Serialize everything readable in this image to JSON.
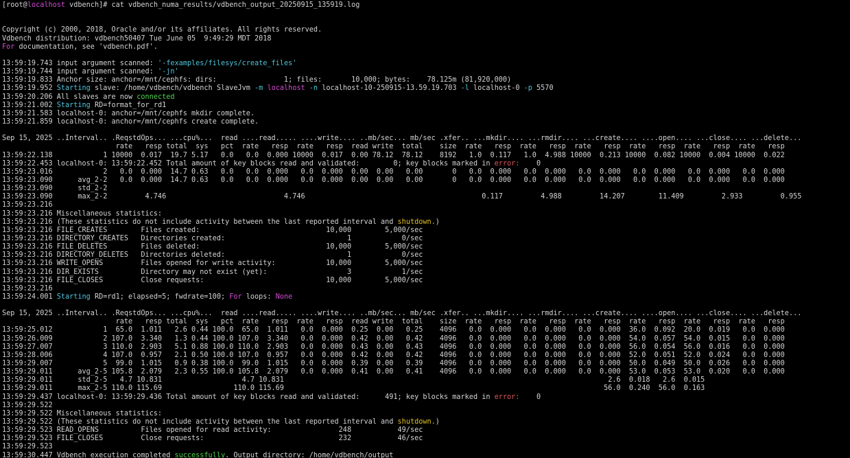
{
  "colors": {
    "background": "#000000",
    "default": "#d3d3d3",
    "host": "#d24ad2",
    "cyan": "#4fc3d9",
    "magenta": "#d24ad2",
    "red": "#e05555",
    "yellow": "#e0c020",
    "green": "#4ed04e"
  },
  "lines": [
    [
      {
        "t": "[root@"
      },
      {
        "t": "localhost",
        "c": "host"
      },
      {
        "t": " vdbench]# cat vdbench_numa_results/vdbench_output_20250915_135919.log"
      }
    ],
    [],
    [],
    [
      {
        "t": "Copyright (c) 2000, 2018, Oracle and/or its affiliates. All rights reserved."
      }
    ],
    [
      {
        "t": "Vdbench distribution: vdbench50407 Tue June 05  9:49:29 MDT 2018"
      }
    ],
    [
      {
        "t": "For",
        "c": "magenta"
      },
      {
        "t": " documentation, see 'vdbench.pdf'."
      }
    ],
    [],
    [
      {
        "t": "13:59:19.743 input argument scanned: "
      },
      {
        "t": "'-fexamples/filesys/create_files'",
        "c": "cyan"
      }
    ],
    [
      {
        "t": "13:59:19.744 input argument scanned: "
      },
      {
        "t": "'-jn'",
        "c": "cyan"
      }
    ],
    [
      {
        "t": "13:59:19.833 Anchor size: anchor=/mnt/cephfs: dirs:                1; files:       10,000; bytes:    78.125m (81,920,000)"
      }
    ],
    [
      {
        "t": "13:59:19.952 "
      },
      {
        "t": "Starting",
        "c": "cyan"
      },
      {
        "t": " slave: /home/vdbench/vdbench SlaveJvm "
      },
      {
        "t": "-m",
        "c": "cyan"
      },
      {
        "t": " "
      },
      {
        "t": "localhost",
        "c": "magenta"
      },
      {
        "t": " "
      },
      {
        "t": "-n",
        "c": "cyan"
      },
      {
        "t": " localhost-10-250915-13.59.19.703 "
      },
      {
        "t": "-l",
        "c": "cyan"
      },
      {
        "t": " localhost-0 "
      },
      {
        "t": "-p",
        "c": "cyan"
      },
      {
        "t": " 5570"
      }
    ],
    [
      {
        "t": "13:59:20.206 All slaves are now "
      },
      {
        "t": "connected",
        "c": "green"
      }
    ],
    [
      {
        "t": "13:59:21.002 "
      },
      {
        "t": "Starting",
        "c": "cyan"
      },
      {
        "t": " RD=format_for_rd1"
      }
    ],
    [
      {
        "t": "13:59:21.583 localhost-0: anchor=/mnt/cephfs mkdir complete."
      }
    ],
    [
      {
        "t": "13:59:21.859 localhost-0: anchor=/mnt/cephfs create complete."
      }
    ],
    [],
    [
      {
        "t": "Sep 15, 2025 ..Interval.. .ReqstdOps... ...cpu%...  read ....read..... ....write.... ..mb/sec... mb/sec .xfer.. ...mkdir.... ...rmdir.... ...create.... ....open.... ...close.... ...delete..."
      }
    ],
    [
      {
        "t": "                           rate   resp total  sys   pct  rate   resp  rate   resp  read write  total    size  rate   resp  rate   resp  rate   resp  rate   resp  rate   resp  rate   resp"
      }
    ],
    [
      {
        "t": "13:59:22.138            1 10000  0.017  19.7 5.17   0.0   0.0  0.000 10000  0.017  0.00 78.12  78.12    8192   1.0  0.117   1.0  4.988 10000  0.213 10000  0.082 10000  0.004 10000  0.022"
      }
    ],
    [
      {
        "t": "13:59:22.453 localhost-0: 13:59:22.452 Total amount of key blocks read and validated:        0; key blocks marked in "
      },
      {
        "t": "error:",
        "c": "red"
      },
      {
        "t": "    0"
      }
    ],
    [
      {
        "t": "13:59:23.016            2   0.0  0.000  14.7 0.63   0.0   0.0  0.000   0.0  0.000  0.00  0.00   0.00       0   0.0  0.000   0.0  0.000   0.0  0.000   0.0  0.000   0.0  0.000   0.0  0.000"
      }
    ],
    [
      {
        "t": "13:59:23.090      avg_2-2   0.0  0.000  14.7 0.63   0.0   0.0  0.000   0.0  0.000  0.00  0.00   0.00       0   0.0  0.000   0.0  0.000   0.0  0.000   0.0  0.000   0.0  0.000   0.0  0.000"
      }
    ],
    [
      {
        "t": "13:59:23.090      std_2-2"
      }
    ],
    [
      {
        "t": "13:59:23.090      max_2-2         4.746                            4.746                                          0.117         4.988         14.207        11.409         2.933         0.955"
      }
    ],
    [
      {
        "t": "13:59:23.216"
      }
    ],
    [
      {
        "t": "13:59:23.216 Miscellaneous statistics:"
      }
    ],
    [
      {
        "t": "13:59:23.216 (These statistics do not include activity between the last reported interval and "
      },
      {
        "t": "shutdown.",
        "c": "yellow"
      },
      {
        "t": ")"
      }
    ],
    [
      {
        "t": "13:59:23.216 FILE_CREATES        Files created:                              10,000        5,000/sec"
      }
    ],
    [
      {
        "t": "13:59:23.216 DIRECTORY_CREATES   Directories created:                             1            0/sec"
      }
    ],
    [
      {
        "t": "13:59:23.216 FILE_DELETES        Files deleted:                              10,000        5,000/sec"
      }
    ],
    [
      {
        "t": "13:59:23.216 DIRECTORY_DELETES   Directories deleted:                             1            0/sec"
      }
    ],
    [
      {
        "t": "13:59:23.216 WRITE_OPENS         Files opened for write activity:            10,000        5,000/sec"
      }
    ],
    [
      {
        "t": "13:59:23.216 DIR_EXISTS          Directory may not exist (yet):                   3            1/sec"
      }
    ],
    [
      {
        "t": "13:59:23.216 FILE_CLOSES         Close requests:                             10,000        5,000/sec"
      }
    ],
    [
      {
        "t": "13:59:23.216"
      }
    ],
    [
      {
        "t": "13:59:24.001 "
      },
      {
        "t": "Starting",
        "c": "cyan"
      },
      {
        "t": " RD=rd1; elapsed=5; fwdrate=100; "
      },
      {
        "t": "For",
        "c": "magenta"
      },
      {
        "t": " loops: "
      },
      {
        "t": "None",
        "c": "magenta"
      }
    ],
    [],
    [
      {
        "t": "Sep 15, 2025 ..Interval.. .ReqstdOps... ...cpu%...  read ....read..... ....write.... ..mb/sec... mb/sec .xfer.. ...mkdir.... ...rmdir.... ...create.... ....open.... ...close.... ...delete..."
      }
    ],
    [
      {
        "t": "                           rate   resp total  sys   pct  rate   resp  rate   resp  read write  total    size  rate   resp  rate   resp  rate   resp  rate   resp  rate   resp  rate   resp"
      }
    ],
    [
      {
        "t": "13:59:25.012            1  65.0  1.011   2.6 0.44 100.0  65.0  1.011   0.0  0.000  0.25  0.00   0.25    4096   0.0  0.000   0.0  0.000   0.0  0.000  36.0  0.092  20.0  0.019   0.0  0.000"
      }
    ],
    [
      {
        "t": "13:59:26.009            2 107.0  3.340   1.3 0.44 100.0 107.0  3.340   0.0  0.000  0.42  0.00   0.42    4096   0.0  0.000   0.0  0.000   0.0  0.000  54.0  0.057  54.0  0.015   0.0  0.000"
      }
    ],
    [
      {
        "t": "13:59:27.007            3 110.0  2.903   5.1 0.88 100.0 110.0  2.903   0.0  0.000  0.43  0.00   0.43    4096   0.0  0.000   0.0  0.000   0.0  0.000  56.0  0.054  56.0  0.016   0.0  0.000"
      }
    ],
    [
      {
        "t": "13:59:28.006            4 107.0  0.957   2.1 0.50 100.0 107.0  0.957   0.0  0.000  0.42  0.00   0.42    4096   0.0  0.000   0.0  0.000   0.0  0.000  52.0  0.051  52.0  0.024   0.0  0.000"
      }
    ],
    [
      {
        "t": "13:59:29.007            5  99.0  1.015   0.9 0.38 100.0  99.0  1.015   0.0  0.000  0.39  0.00   0.39    4096   0.0  0.000   0.0  0.000   0.0  0.000  50.0  0.049  50.0  0.026   0.0  0.000"
      }
    ],
    [
      {
        "t": "13:59:29.011      avg_2-5 105.8  2.079   2.3 0.55 100.0 105.8  2.079   0.0  0.000  0.41  0.00   0.41    4096   0.0  0.000   0.0  0.000   0.0  0.000  53.0  0.053  53.0  0.020   0.0  0.000"
      }
    ],
    [
      {
        "t": "13:59:29.011      std_2-5   4.7 10.831                   4.7 10.831                                                                             2.6  0.018   2.6  0.015"
      }
    ],
    [
      {
        "t": "13:59:29.011      max_2-5 110.0 115.69                 110.0 115.69                                                                            56.0  0.240  56.0  0.163"
      }
    ],
    [
      {
        "t": "13:59:29.437 localhost-0: 13:59:29.436 Total amount of key blocks read and validated:      491; key blocks marked in "
      },
      {
        "t": "error:",
        "c": "red"
      },
      {
        "t": "    0"
      }
    ],
    [
      {
        "t": "13:59:29.522"
      }
    ],
    [
      {
        "t": "13:59:29.522 Miscellaneous statistics:"
      }
    ],
    [
      {
        "t": "13:59:29.522 (These statistics do not include activity between the last reported interval and "
      },
      {
        "t": "shutdown.",
        "c": "yellow"
      },
      {
        "t": ")"
      }
    ],
    [
      {
        "t": "13:59:29.523 READ_OPENS          Files opened for read activity:                248           49/sec"
      }
    ],
    [
      {
        "t": "13:59:29.523 FILE_CLOSES         Close requests:                                232           46/sec"
      }
    ],
    [
      {
        "t": "13:59:29.523"
      }
    ],
    [
      {
        "t": "13:59:30.447 Vdbench execution completed "
      },
      {
        "t": "successfully",
        "c": "green"
      },
      {
        "t": ". Output directory: /home/vdbench/output"
      }
    ]
  ]
}
